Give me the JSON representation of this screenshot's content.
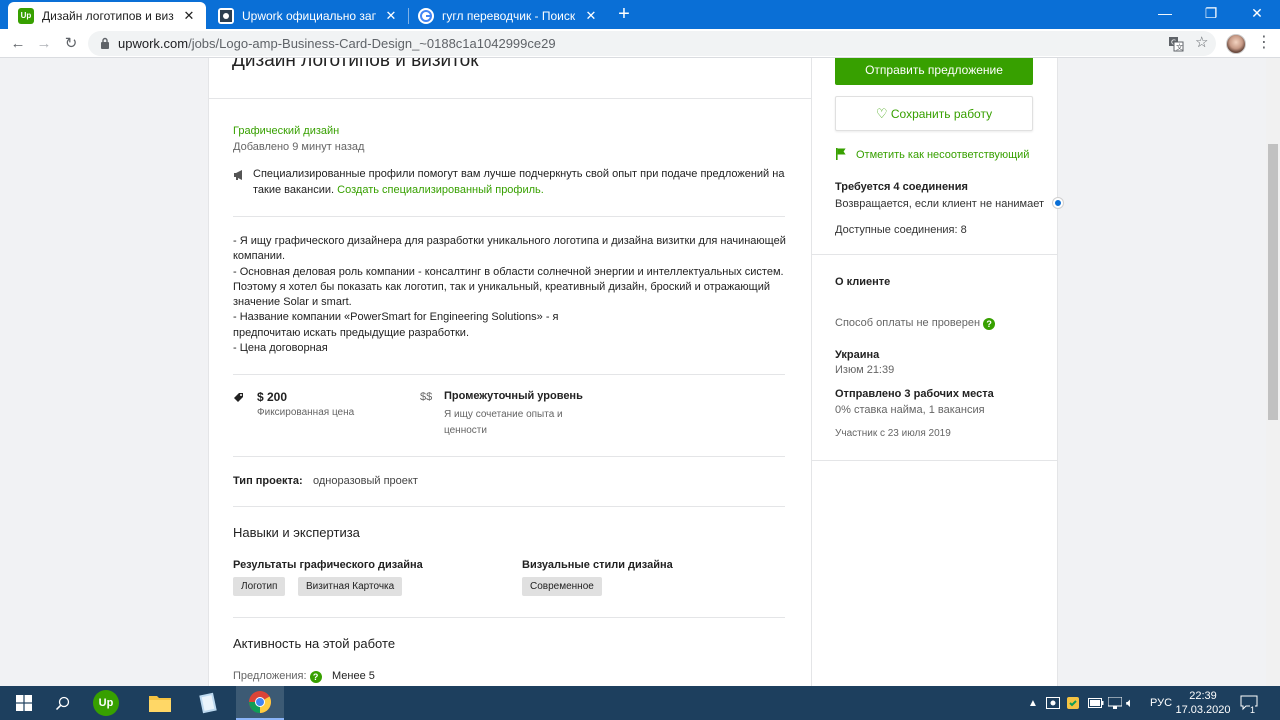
{
  "browser": {
    "tabs": [
      {
        "title": "Дизайн логотипов и визиток - Ар",
        "active": true
      },
      {
        "title": "Upwork официально запрещает",
        "active": false
      },
      {
        "title": "гугл переводчик - Поиск в Goog",
        "active": false
      }
    ],
    "url_host": "upwork.com",
    "url_path": "/jobs/Logo-amp-Business-Card-Design_~0188c1a1042999ce29"
  },
  "job": {
    "title": "Дизайн логотипов и визиток",
    "category": "Графический дизайн",
    "posted": "Добавлено 9 минут назад",
    "profile_note": {
      "line1": "Специализированные профили помогут вам лучше подчеркнуть свой опыт при подаче предложений на",
      "line2": "такие вакансии.",
      "link": "Создать специализированный профиль."
    },
    "description": [
      "- Я ищу графического дизайнера для разработки уникального логотипа и дизайна визитки для начинающей",
      "компании.",
      "- Основная деловая роль компании - консалтинг в области солнечной энергии и интеллектуальных систем.",
      "Поэтому я хотел бы показать как логотип, так и уникальный, креативный дизайн, броский и отражающий",
      "значение Solar и smart.",
      "- Название компании «PowerSmart for Engineering Solutions» - я",
      "предпочитаю искать предыдущие разработки.",
      "- Цена договорная"
    ],
    "price": "$ 200",
    "price_type": "Фиксированная цена",
    "level_icon": "$$",
    "level": "Промежуточный уровень",
    "level_desc_1": "Я ищу сочетание опыта и",
    "level_desc_2": "ценности",
    "project_type_label": "Тип проекта:",
    "project_type": "одноразовый проект",
    "skills_heading": "Навыки и экспертиза",
    "skill_groups": [
      {
        "title": "Результаты графического дизайна",
        "chips": [
          "Логотип",
          "Визитная Карточка"
        ]
      },
      {
        "title": "Визуальные стили дизайна",
        "chips": [
          "Современное"
        ]
      }
    ],
    "activity_heading": "Активность на этой работе",
    "proposals_label": "Предложения:",
    "proposals_value": "Менее 5"
  },
  "sidebar": {
    "submit": "Отправить предложение",
    "save": "Сохранить работу",
    "flag": "Отметить как несоответствующий",
    "connects_required": "Требуется 4 соединения",
    "connects_refund": "Возвращается, если клиент не нанимает",
    "connects_available": "Доступные соединения: 8",
    "client_heading": "О клиенте",
    "payment": "Способ оплаты не проверен",
    "country": "Украина",
    "city_time": "Изюм 21:39",
    "jobs_posted": "Отправлено 3 рабочих места",
    "hire_rate": "0% ставка найма, 1 вакансия",
    "member_since": "Участник с 23 июля 2019"
  },
  "taskbar": {
    "lang": "РУС",
    "time": "22:39",
    "date": "17.03.2020",
    "notifications": "1"
  },
  "colors": {
    "accent": "#37a000",
    "tabbar": "#0a6fd6",
    "taskbar": "#1d3f5e"
  }
}
